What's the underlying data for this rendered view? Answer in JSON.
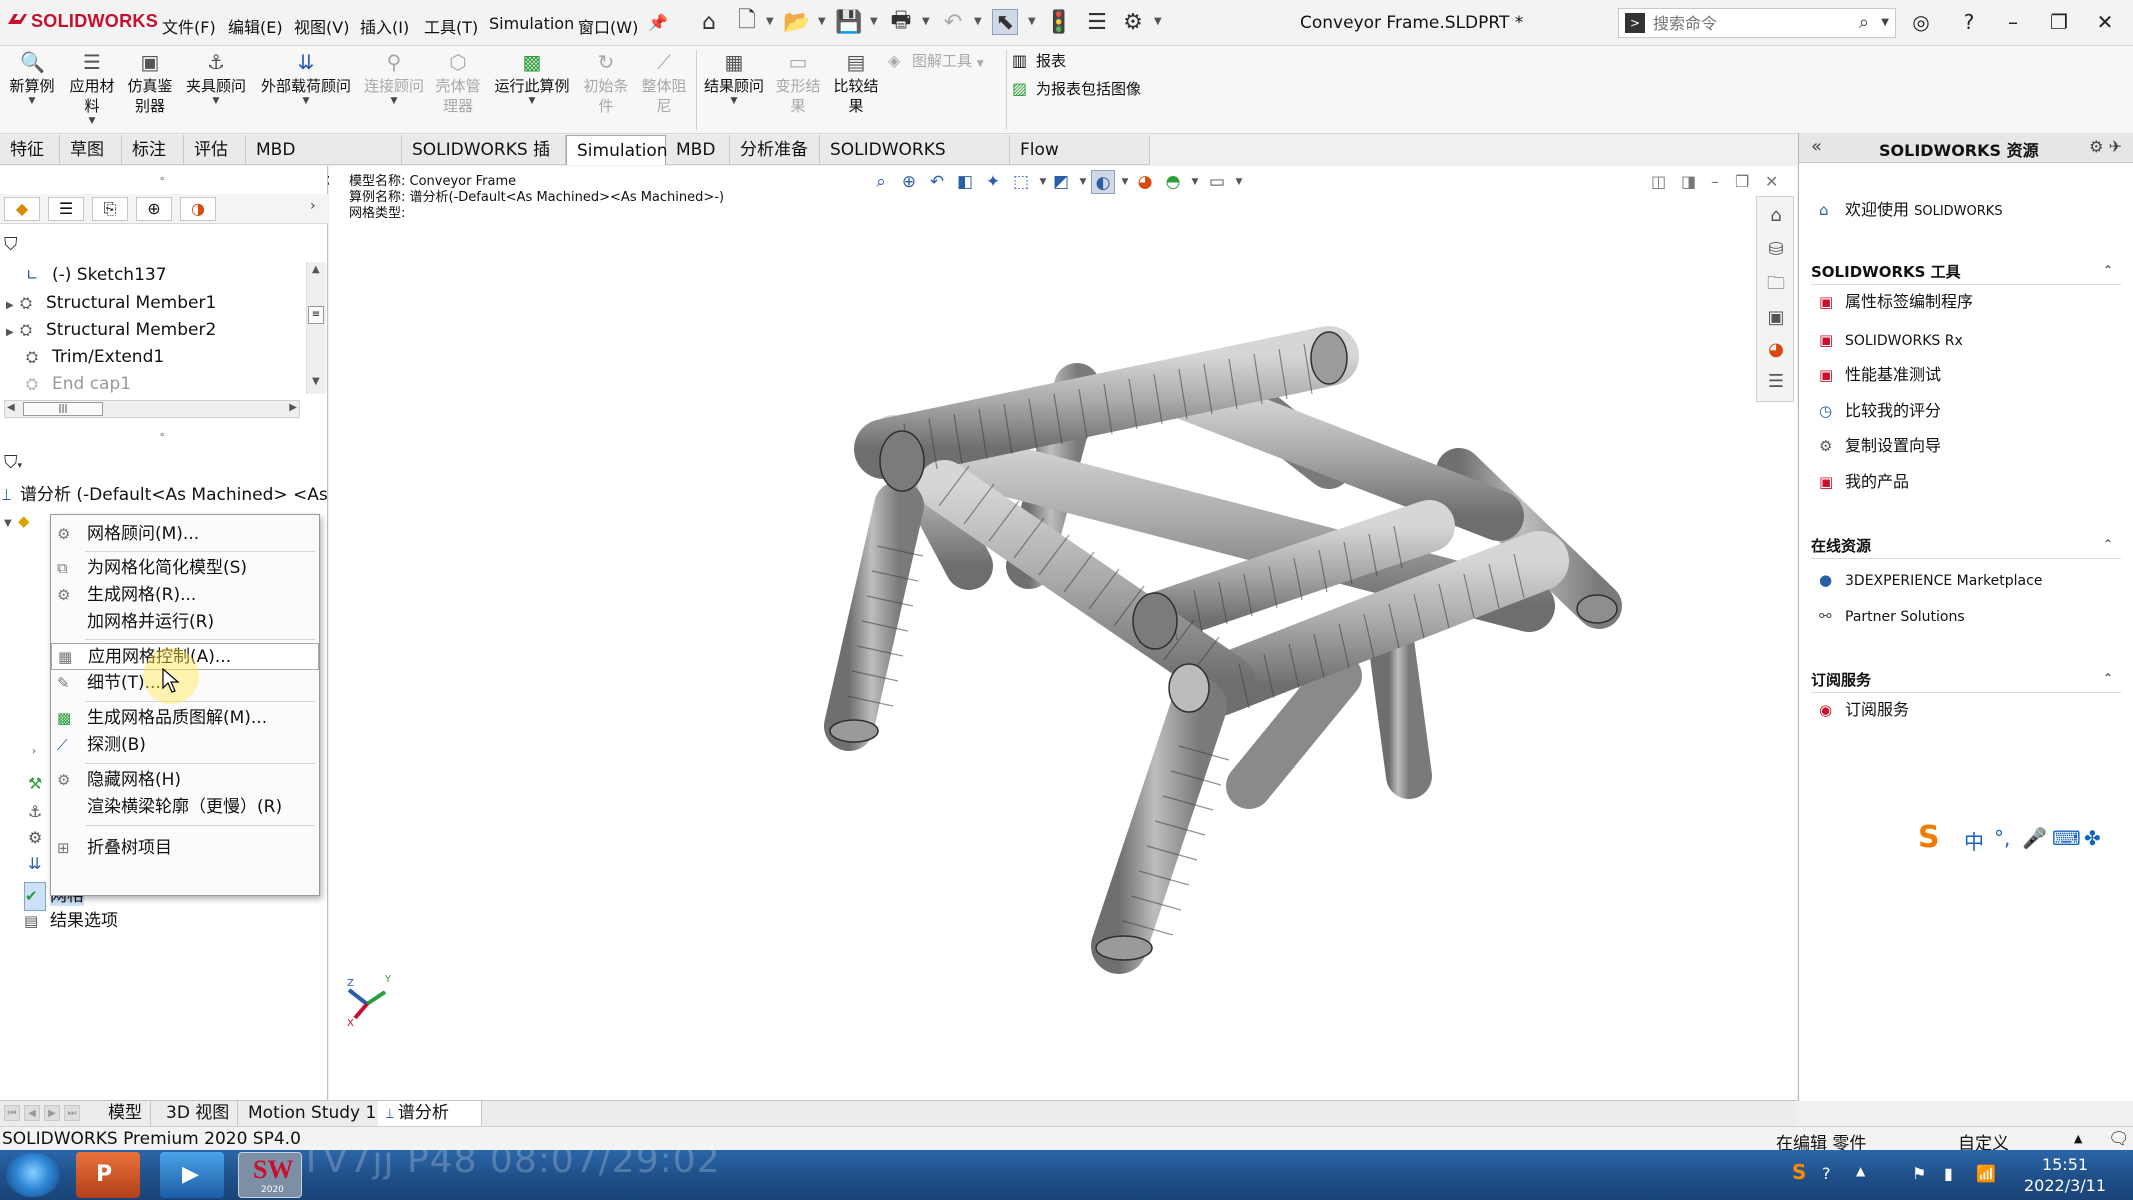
{
  "app": {
    "brand": "SOLIDWORKS",
    "document_title": "Conveyor Frame.SLDPRT *",
    "menu": [
      "文件(F)",
      "编辑(E)",
      "视图(V)",
      "插入(I)",
      "工具(T)",
      "Simulation",
      "窗口(W)"
    ],
    "search_placeholder": "搜索命令"
  },
  "ribbon": {
    "buttons": [
      {
        "label1": "新算例",
        "label2": "",
        "label3": "",
        "icon": "new-study-icon",
        "enabled": true
      },
      {
        "label1": "应用材",
        "label2": "料",
        "label3": "",
        "icon": "apply-material-icon",
        "enabled": true
      },
      {
        "label1": "仿真鉴",
        "label2": "别器",
        "label3": "",
        "icon": "simulation-evaluator-icon",
        "enabled": true
      },
      {
        "label1": "夹具顾问",
        "label2": "",
        "label3": "",
        "icon": "fixtures-advisor-icon",
        "enabled": true
      },
      {
        "label1": "外部载荷顾问",
        "label2": "",
        "label3": "",
        "icon": "external-loads-icon",
        "enabled": true
      },
      {
        "label1": "连接顾问",
        "label2": "",
        "label3": "",
        "icon": "connections-advisor-icon",
        "enabled": false
      },
      {
        "label1": "壳体管",
        "label2": "理器",
        "label3": "",
        "icon": "shell-manager-icon",
        "enabled": false
      },
      {
        "label1": "运行此算例",
        "label2": "",
        "label3": "",
        "icon": "run-study-icon",
        "enabled": true
      },
      {
        "label1": "初始条",
        "label2": "件",
        "label3": "",
        "icon": "initial-condition-icon",
        "enabled": false
      },
      {
        "label1": "整体阻",
        "label2": "尼",
        "label3": "",
        "icon": "global-damping-icon",
        "enabled": false
      },
      {
        "label1": "结果顾问",
        "label2": "",
        "label3": "",
        "icon": "results-advisor-icon",
        "enabled": true
      },
      {
        "label1": "变形结",
        "label2": "果",
        "label3": "",
        "icon": "deformed-result-icon",
        "enabled": false
      },
      {
        "label1": "比较结",
        "label2": "果",
        "label3": "",
        "icon": "compare-results-icon",
        "enabled": true
      }
    ],
    "small": {
      "plot_tools": "图解工具",
      "report": "报表",
      "include_image": "为报表包括图像"
    }
  },
  "tabs": [
    "特征",
    "草图",
    "标注",
    "评估",
    "MBD Dimensions",
    "SOLIDWORKS 插件",
    "Simulation",
    "MBD",
    "分析准备",
    "SOLIDWORKS Plastics",
    "Flow Simulation"
  ],
  "active_tab": "Simulation",
  "feature_tree": [
    {
      "label": "(-) Sketch137",
      "icon": "sketch-icon",
      "grey": false,
      "expand": false
    },
    {
      "label": "Structural Member1",
      "icon": "structural-member-icon",
      "grey": false,
      "expand": true
    },
    {
      "label": "Structural Member2",
      "icon": "structural-member-icon",
      "grey": false,
      "expand": true
    },
    {
      "label": "Trim/Extend1",
      "icon": "trim-extend-icon",
      "grey": false,
      "expand": false
    },
    {
      "label": "End cap1",
      "icon": "end-cap-icon",
      "grey": true,
      "expand": false
    }
  ],
  "study_tree": {
    "root": "谱分析 (-Default<As Machined> <As Mac",
    "mesh_label": "网格",
    "results_options": "结果选项"
  },
  "context_menu": [
    {
      "label": "网格顾问(M)...",
      "icon": "mesh-advisor-icon",
      "highlight": false
    },
    {
      "label": "为网格化简化模型(S)",
      "icon": "simplify-icon",
      "highlight": false
    },
    {
      "label": "生成网格(R)...",
      "icon": "create-mesh-icon",
      "highlight": false
    },
    {
      "label": "加网格并运行(R)",
      "icon": "",
      "highlight": false
    },
    {
      "label": "应用网格控制(A)...",
      "icon": "mesh-control-icon",
      "highlight": true
    },
    {
      "label": "细节(T)...",
      "icon": "details-icon",
      "highlight": false
    },
    {
      "label": "生成网格品质图解(M)...",
      "icon": "mesh-quality-icon",
      "highlight": false
    },
    {
      "label": "探测(B)",
      "icon": "probe-icon",
      "highlight": false
    },
    {
      "label": "隐藏网格(H)",
      "icon": "hide-mesh-icon",
      "highlight": false
    },
    {
      "label": "渲染横梁轮廓（更慢）(R)",
      "icon": "",
      "highlight": false
    },
    {
      "label": "折叠树项目",
      "icon": "collapse-tree-icon",
      "highlight": false
    }
  ],
  "viewport": {
    "model_name": "模型名称: Conveyor Frame",
    "study_name": "算例名称: 谱分析(-Default<As Machined><As Machined>-)",
    "mesh_type": "网格类型:",
    "axis_x": "X",
    "axis_y": "Y",
    "axis_z": "Z"
  },
  "task_pane": {
    "title": "SOLIDWORKS 资源",
    "welcome": "欢迎使用",
    "welcome_brand": "SOLIDWORKS",
    "sections": [
      {
        "title": "SOLIDWORKS 工具",
        "items": [
          "属性标签编制程序",
          "SOLIDWORKS Rx",
          "性能基准测试",
          "比较我的评分",
          "复制设置向导",
          "我的产品"
        ]
      },
      {
        "title": "在线资源",
        "items": [
          "3DEXPERIENCE Marketplace",
          "Partner Solutions"
        ]
      },
      {
        "title": "订阅服务",
        "items": [
          "订阅服务"
        ]
      }
    ]
  },
  "ime": {
    "mode": "中"
  },
  "bottom_tabs": [
    "模型",
    "3D 视图",
    "Motion Study 1",
    "谱分析"
  ],
  "active_bottom_tab": "谱分析",
  "status": {
    "version": "SOLIDWORKS Premium 2020 SP4.0",
    "editing": "在编辑 零件",
    "custom": "自定义"
  },
  "taskbar": {
    "overlay": "TV7jj P48 08:07/29:02",
    "time": "15:51",
    "date": "2022/3/11",
    "sw_badge": "2020"
  }
}
